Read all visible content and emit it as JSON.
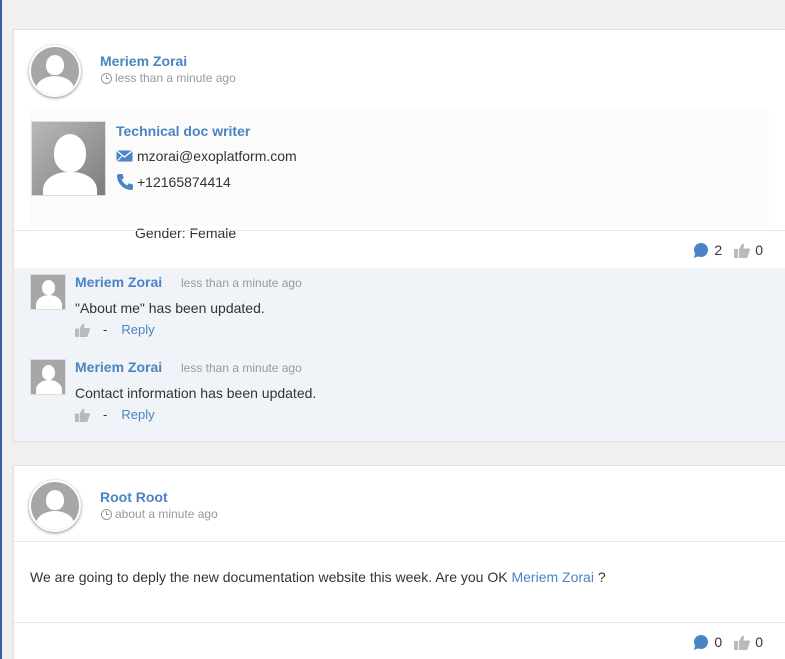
{
  "activity1": {
    "author": "Meriem Zorai",
    "time": "less than a minute ago",
    "profile": {
      "job_title": "Technical doc writer",
      "email": "mzorai@exoplatform.com",
      "phone": "+12165874414",
      "gender": "Gender: Female"
    },
    "comment_count": "2",
    "like_count": "0",
    "comments": [
      {
        "author": "Meriem Zorai",
        "time": "less than a minute ago",
        "text": "\"About me\" has been updated.",
        "separator": "-",
        "reply": "Reply"
      },
      {
        "author": "Meriem Zorai",
        "time": "less than a minute ago",
        "text": "Contact information has been updated.",
        "separator": "-",
        "reply": "Reply"
      }
    ]
  },
  "activity2": {
    "author": "Root Root",
    "time": "about a minute ago",
    "text_before": "We are going to deply the new documentation website this week. Are you OK ",
    "mention": "Meriem Zorai",
    "text_after": " ?",
    "comment_count": "0",
    "like_count": "0"
  },
  "colors": {
    "link": "#4a84c4",
    "comment_icon": "#4a84c4",
    "like_icon": "#b9b9b9",
    "comments_bg": "#f0f3f7"
  },
  "icons": [
    "clock-icon",
    "mail-icon",
    "phone-icon",
    "comment-icon",
    "like-icon"
  ]
}
